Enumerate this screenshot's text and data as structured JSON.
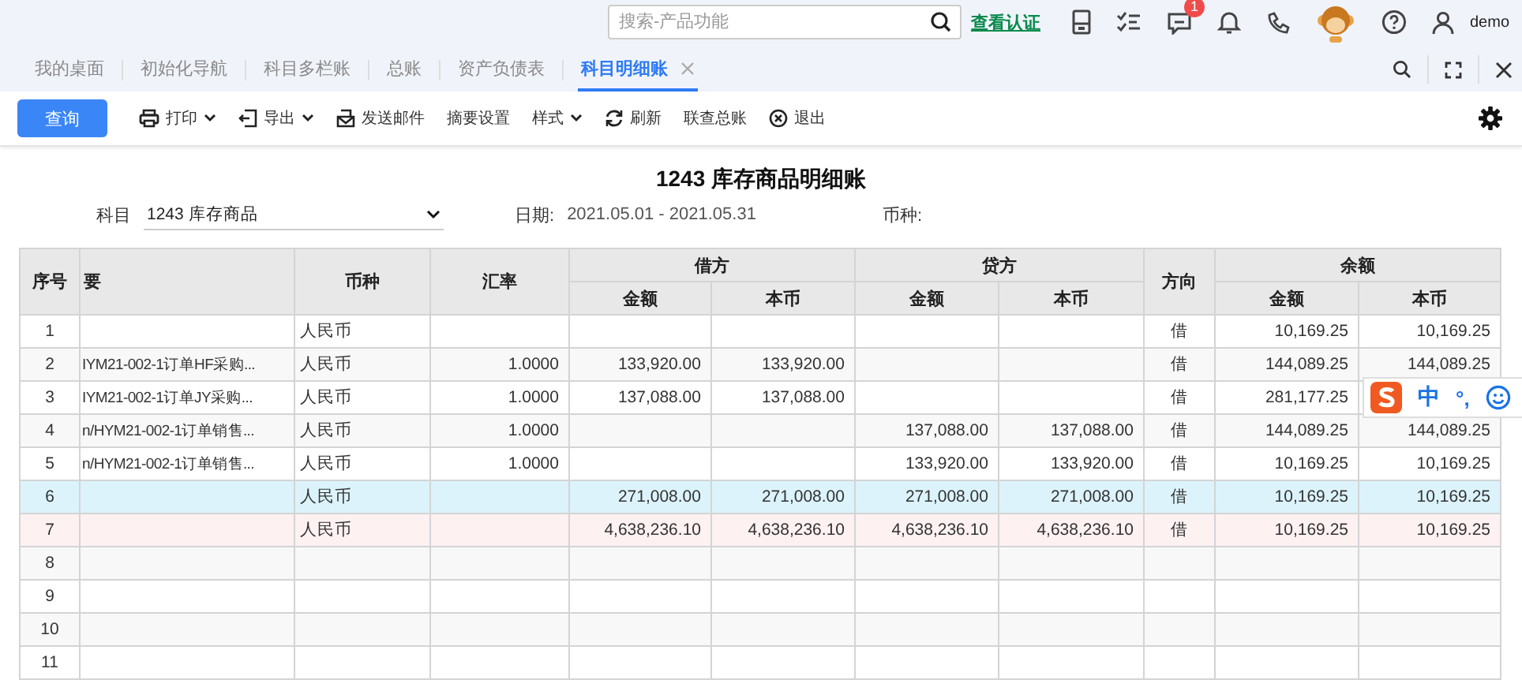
{
  "topbar": {
    "search": {
      "placeholder": "搜索-产品功能"
    },
    "verify_link": "查看认证",
    "message_badge": "1",
    "user": "demo"
  },
  "tabs": [
    {
      "label": "我的桌面",
      "selected": false,
      "closable": false
    },
    {
      "label": "初始化导航",
      "selected": false,
      "closable": false
    },
    {
      "label": "科目多栏账",
      "selected": false,
      "closable": false
    },
    {
      "label": "总账",
      "selected": false,
      "closable": false
    },
    {
      "label": "资产负债表",
      "selected": false,
      "closable": false
    },
    {
      "label": "科目明细账",
      "selected": true,
      "closable": true
    }
  ],
  "toolbar": {
    "query_button": "查询",
    "items": [
      {
        "kind": "print",
        "label": "打印",
        "dropdown": true
      },
      {
        "kind": "export",
        "label": "导出",
        "dropdown": true
      },
      {
        "kind": "mail",
        "label": "发送邮件",
        "dropdown": false
      },
      {
        "kind": "plain",
        "label": "摘要设置",
        "dropdown": false
      },
      {
        "kind": "plain",
        "label": "样式",
        "dropdown": true
      },
      {
        "kind": "refresh",
        "label": "刷新",
        "dropdown": false
      },
      {
        "kind": "plain",
        "label": "联查总账",
        "dropdown": false
      },
      {
        "kind": "exit",
        "label": "退出",
        "dropdown": false
      }
    ]
  },
  "report": {
    "title": "1243 库存商品明细账",
    "account_label": "科目",
    "account_value": "1243 库存商品",
    "date_label": "日期:",
    "date_value": "2021.05.01 - 2021.05.31",
    "currency_label": "币种:"
  },
  "table": {
    "head": {
      "seq": "序号",
      "summary": "要",
      "currency": "币种",
      "rate": "汇率",
      "debit": "借方",
      "credit": "贷方",
      "direction": "方向",
      "balance": "余额",
      "sub": [
        "金额",
        "本币",
        "金额",
        "本币",
        "金额",
        "本币"
      ]
    },
    "rows": [
      {
        "kind": "normal",
        "cells": [
          "1",
          null,
          "人民币",
          null,
          null,
          null,
          null,
          null,
          "借",
          "10,169.25",
          "10,169.25"
        ]
      },
      {
        "kind": "normal",
        "cells": [
          "2",
          "IYM21-002-1订单HF采购...",
          "人民币",
          "1.0000",
          "133,920.00",
          "133,920.00",
          null,
          null,
          "借",
          "144,089.25",
          "144,089.25"
        ]
      },
      {
        "kind": "normal",
        "cells": [
          "3",
          "IYM21-002-1订单JY采购...",
          "人民币",
          "1.0000",
          "137,088.00",
          "137,088.00",
          null,
          null,
          "借",
          "281,177.25",
          null
        ]
      },
      {
        "kind": "normal",
        "cells": [
          "4",
          "n/HYM21-002-1订单销售...",
          "人民币",
          "1.0000",
          null,
          null,
          "137,088.00",
          "137,088.00",
          "借",
          "144,089.25",
          "144,089.25"
        ]
      },
      {
        "kind": "normal",
        "cells": [
          "5",
          "n/HYM21-002-1订单销售...",
          "人民币",
          "1.0000",
          null,
          null,
          "133,920.00",
          "133,920.00",
          "借",
          "10,169.25",
          "10,169.25"
        ]
      },
      {
        "kind": "subtotal",
        "cells": [
          "6",
          null,
          "人民币",
          null,
          "271,008.00",
          "271,008.00",
          "271,008.00",
          "271,008.00",
          "借",
          "10,169.25",
          "10,169.25"
        ]
      },
      {
        "kind": "total",
        "cells": [
          "7",
          null,
          "人民币",
          null,
          "4,638,236.10",
          "4,638,236.10",
          "4,638,236.10",
          "4,638,236.10",
          "借",
          "10,169.25",
          "10,169.25"
        ]
      },
      {
        "kind": "normal",
        "cells": [
          "8",
          null,
          null,
          null,
          null,
          null,
          null,
          null,
          null,
          null,
          null
        ]
      },
      {
        "kind": "normal",
        "cells": [
          "9",
          null,
          null,
          null,
          null,
          null,
          null,
          null,
          null,
          null,
          null
        ]
      },
      {
        "kind": "normal",
        "cells": [
          "10",
          null,
          null,
          null,
          null,
          null,
          null,
          null,
          null,
          null,
          null
        ]
      },
      {
        "kind": "normal",
        "cells": [
          "11",
          null,
          null,
          null,
          null,
          null,
          null,
          null,
          null,
          null,
          null
        ]
      }
    ]
  },
  "ime": {
    "mode": "中",
    "punct": "°,"
  }
}
